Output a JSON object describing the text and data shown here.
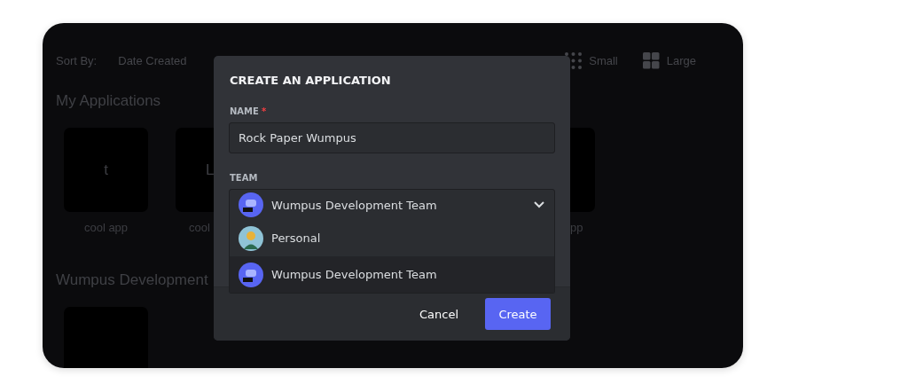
{
  "toolbar": {
    "sort_label": "Sort By:",
    "sort_value": "Date Created",
    "views": [
      {
        "kind": "small",
        "label": "Small"
      },
      {
        "kind": "large",
        "label": "Large"
      }
    ]
  },
  "sections": [
    {
      "title": "My Applications",
      "apps": [
        {
          "kind": "tile",
          "initials": "t",
          "name": "cool app"
        },
        {
          "kind": "tile",
          "initials": "L",
          "name": "cool"
        },
        {
          "kind": "tile",
          "name": "pp"
        }
      ]
    },
    {
      "title": "Wumpus Development",
      "apps": [
        {
          "kind": "tile"
        }
      ]
    }
  ],
  "modal": {
    "title": "CREATE AN APPLICATION",
    "name_field": {
      "label": "NAME",
      "required_mark": "*",
      "value": "Rock Paper Wumpus"
    },
    "team_field": {
      "label": "TEAM",
      "value": "Wumpus Development Team",
      "expanded": true,
      "options": [
        {
          "label": "Personal",
          "kind": "person",
          "selected": false
        },
        {
          "label": "Wumpus Development Team",
          "kind": "mascot",
          "selected": true
        }
      ]
    },
    "buttons": [
      {
        "kind": "secondary",
        "label": "Cancel"
      },
      {
        "kind": "primary",
        "label": "Create"
      }
    ]
  }
}
